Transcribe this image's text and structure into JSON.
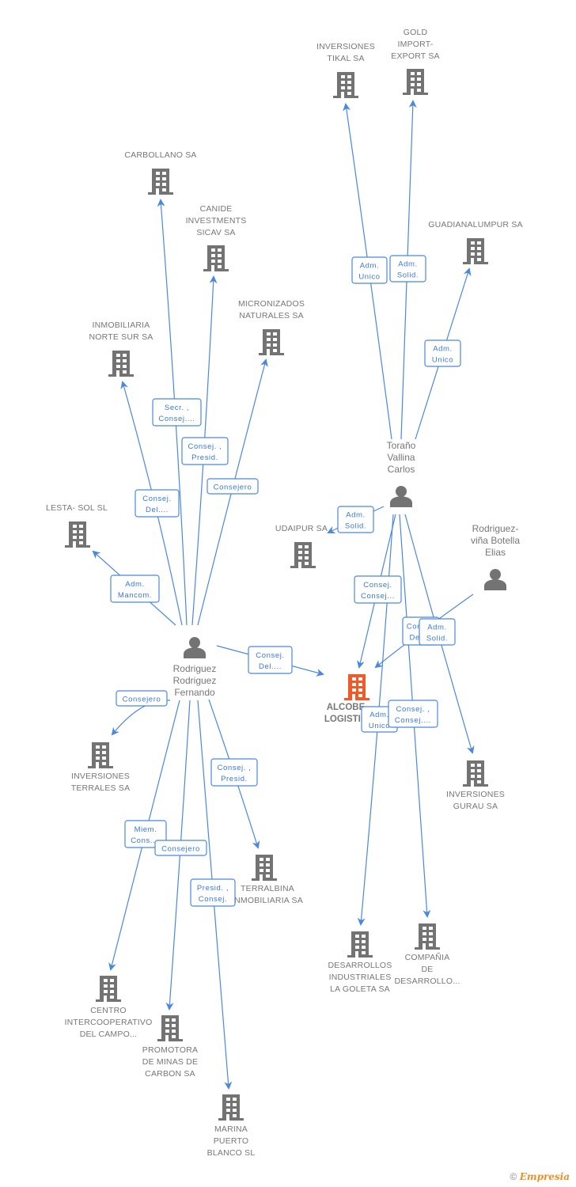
{
  "colors": {
    "edge": "#4a88e0",
    "node": "#737373",
    "focus": "#f05a28"
  },
  "nodes": [
    {
      "id": "tikal",
      "type": "company",
      "label": [
        "INVERSIONES",
        "TIKAL SA"
      ]
    },
    {
      "id": "gold",
      "type": "company",
      "label": [
        "GOLD",
        "IMPORT-",
        "EXPORT SA"
      ]
    },
    {
      "id": "carbollano",
      "type": "company",
      "label": [
        "CARBOLLANO SA"
      ]
    },
    {
      "id": "canide",
      "type": "company",
      "label": [
        "CANIDE",
        "INVESTMENTS",
        "SICAV SA"
      ]
    },
    {
      "id": "guadiana",
      "type": "company",
      "label": [
        "GUADIANALUMPUR SA"
      ]
    },
    {
      "id": "micronizados",
      "type": "company",
      "label": [
        "MICRONIZADOS",
        "NATURALES SA"
      ]
    },
    {
      "id": "inmobiliaria",
      "type": "company",
      "label": [
        "INMOBILIARIA",
        "NORTE SUR SA"
      ]
    },
    {
      "id": "lesta",
      "type": "company",
      "label": [
        "LESTA- SOL SL"
      ]
    },
    {
      "id": "udaipur",
      "type": "company",
      "label": [
        "UDAIPUR SA"
      ]
    },
    {
      "id": "alcobe",
      "type": "focus",
      "label": [
        "ALCOBE",
        "LOGISTIC"
      ]
    },
    {
      "id": "terrales",
      "type": "company",
      "label": [
        "INVERSIONES",
        "TERRALES SA"
      ]
    },
    {
      "id": "gurau",
      "type": "company",
      "label": [
        "INVERSIONES",
        "GURAU SA"
      ]
    },
    {
      "id": "terralbina",
      "type": "company",
      "label": [
        "TERRALBINA",
        "INMOBILIARIA SA"
      ]
    },
    {
      "id": "goleta",
      "type": "company",
      "label": [
        "DESARROLLOS",
        "INDUSTRIALES",
        "LA GOLETA SA"
      ]
    },
    {
      "id": "compania",
      "type": "company",
      "label": [
        "COMPAÑIA",
        "DE",
        "DESARROLLO..."
      ]
    },
    {
      "id": "centro",
      "type": "company",
      "label": [
        "CENTRO",
        "INTERCOOPERATIVO",
        "DEL CAMPO..."
      ]
    },
    {
      "id": "promotora",
      "type": "company",
      "label": [
        "PROMOTORA",
        "DE MINAS DE",
        "CARBON SA"
      ]
    },
    {
      "id": "marina",
      "type": "company",
      "label": [
        "MARINA",
        "PUERTO",
        "BLANCO SL"
      ]
    },
    {
      "id": "torano",
      "type": "person",
      "label": [
        "Toraño",
        "Vallina",
        "Carlos"
      ]
    },
    {
      "id": "elias",
      "type": "person",
      "label": [
        "Rodriguez-",
        "viña Botella",
        "Elias"
      ]
    },
    {
      "id": "fernando",
      "type": "person",
      "label": [
        "Rodriguez",
        "Rodriguez",
        "Fernando"
      ]
    }
  ],
  "edges": [
    {
      "from": "fernando",
      "to": "carbollano",
      "role": [
        "Secr. ,",
        "Consej...."
      ]
    },
    {
      "from": "fernando",
      "to": "canide",
      "role": [
        "Consej. ,",
        "Presid."
      ]
    },
    {
      "from": "fernando",
      "to": "micronizados",
      "role": [
        "Consejero"
      ]
    },
    {
      "from": "fernando",
      "to": "inmobiliaria",
      "role": [
        "Consej.",
        "Del...."
      ]
    },
    {
      "from": "fernando",
      "to": "lesta",
      "role": [
        "Adm.",
        "Mancom."
      ]
    },
    {
      "from": "fernando",
      "to": "alcobe",
      "role": [
        "Consej.",
        "Del...."
      ]
    },
    {
      "from": "fernando",
      "to": "terrales",
      "role": [
        "Consejero"
      ]
    },
    {
      "from": "fernando",
      "to": "terralbina",
      "role": [
        "Consej. ,",
        "Presid."
      ]
    },
    {
      "from": "fernando",
      "to": "centro",
      "role": [
        "Miem.",
        "Cons...."
      ]
    },
    {
      "from": "fernando",
      "to": "promotora",
      "role": [
        "Consejero"
      ]
    },
    {
      "from": "fernando",
      "to": "marina",
      "role": [
        "Presid. ,",
        "Consej."
      ]
    },
    {
      "from": "torano",
      "to": "tikal",
      "role": [
        "Adm.",
        "Unico"
      ]
    },
    {
      "from": "torano",
      "to": "gold",
      "role": [
        "Adm.",
        "Solid."
      ]
    },
    {
      "from": "torano",
      "to": "guadiana",
      "role": [
        "Adm.",
        "Unico"
      ]
    },
    {
      "from": "torano",
      "to": "udaipur",
      "role": [
        "Adm.",
        "Solid."
      ]
    },
    {
      "from": "torano",
      "to": "alcobe",
      "role": [
        "Consej.",
        "Consej..."
      ]
    },
    {
      "from": "elias",
      "to": "alcobe",
      "role": [
        "Consej.",
        "Del...."
      ]
    },
    {
      "from": "torano",
      "to": "gurau",
      "role": [
        "Adm.",
        "Solid."
      ]
    },
    {
      "from": "torano",
      "to": "goleta",
      "role": [
        "Adm.",
        "Unico"
      ]
    },
    {
      "from": "torano",
      "to": "compania",
      "role": [
        "Consej. ,",
        "Consej...."
      ]
    }
  ],
  "footer": {
    "copyright": "©",
    "brand": "Empresia"
  }
}
